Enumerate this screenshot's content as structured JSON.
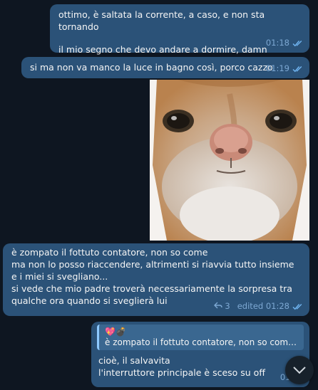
{
  "messages": [
    {
      "line1": "ottimo, è saltata la corrente, a caso, e non sta tornando",
      "line2": "il mio segno che devo andare a dormire, damn",
      "time": "01:18"
    },
    {
      "text": "si ma non va manco la luce in bagno così, porco cazzo",
      "time": "01:19"
    },
    {
      "text": "è zompato il fottuto contatore, non so come\nma non lo posso riaccendere, altrimenti si riavvia tutto insieme e i miei si svegliano...\nsi vede che mio padre troverà necessariamente la sorpresa tra qualche ora quando si sveglierà lui",
      "replies": "3",
      "status": "edited 01:28"
    },
    {
      "quote_emoji": "💖💣",
      "quote_text": "è zompato il fottuto contatore, non so come...",
      "text": "cioè, il salvavita\nl'interruttore principale è sceso su off",
      "time": "01:29"
    }
  ],
  "photo": {
    "subject": "cat-face-photo"
  },
  "colors": {
    "background": "#0e1621",
    "bubble": "#2b5278",
    "accent": "#6fb4f0"
  },
  "icons": [
    "double-check-icon",
    "reply-icon",
    "scroll-down-icon"
  ]
}
